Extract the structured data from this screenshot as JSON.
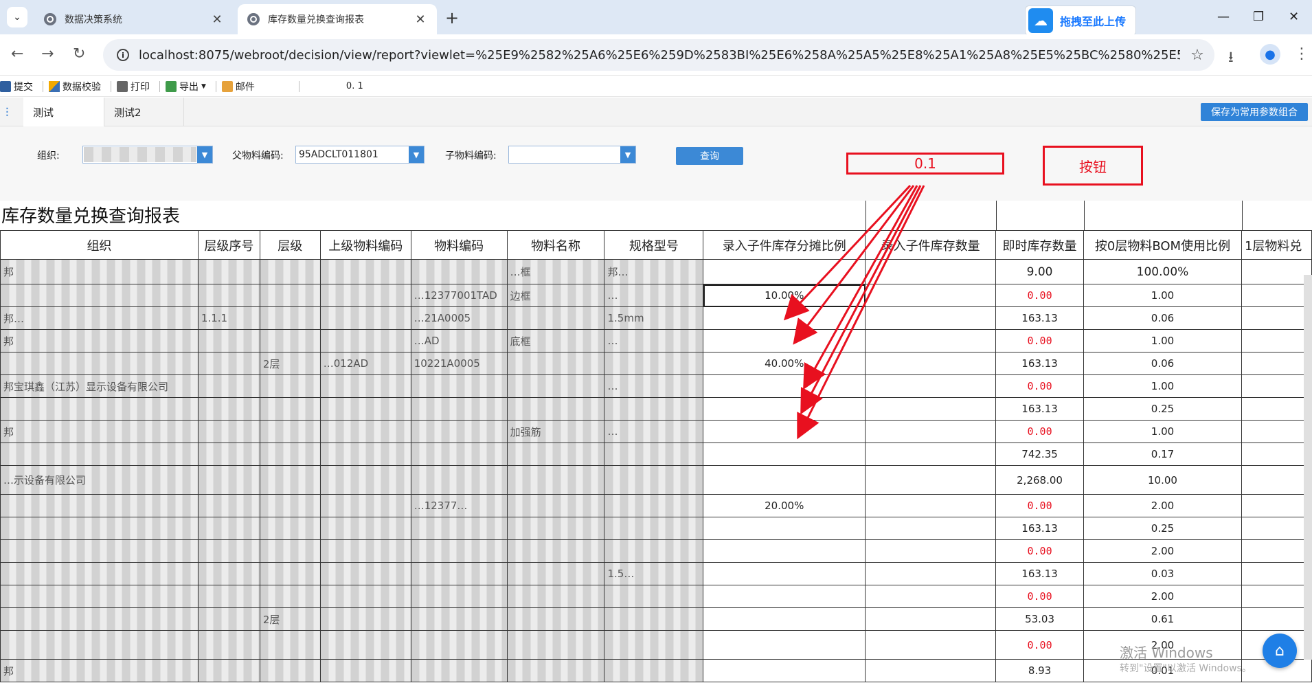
{
  "browser": {
    "tabs": [
      {
        "title": "数据决策系统",
        "active": false
      },
      {
        "title": "库存数量兑换查询报表",
        "active": true
      }
    ],
    "new_tab": "+",
    "upload_label": "拖拽至此上传",
    "url": "localhost:8075/webroot/decision/view/report?viewlet=%25E9%2582%25A6%25E6%259D%2583BI%25E6%258A%25A5%25E8%25A1%25A8%25E5%25BC%2580%25E5%258F%259..."
  },
  "toolbar": {
    "items": [
      "提交",
      "数据校验",
      "打印",
      "导出",
      "邮件"
    ],
    "value_text": "0. 1"
  },
  "param_tabs": {
    "tabs": [
      "测试",
      "测试2"
    ],
    "save_button": "保存为常用参数组合"
  },
  "params": {
    "org_label": "组织:",
    "parent_code_label": "父物料编码:",
    "parent_code_value": "95ADCLT011801",
    "child_code_label": "子物料编码:",
    "child_code_value": "",
    "query_button": "查询"
  },
  "annotations": {
    "value_box": "0.1",
    "button_box": "按钮"
  },
  "report": {
    "title": "库存数量兑换查询报表",
    "columns": [
      "组织",
      "层级序号",
      "层级",
      "上级物料编码",
      "物料编码",
      "物料名称",
      "规格型号",
      "录入子件库存分摊比例",
      "录入子件库存数量",
      "即时库存数量",
      "按0层物料BOM使用比例",
      "1层物料兑"
    ],
    "rows": [
      {
        "org": "邦",
        "seq": "",
        "level": "",
        "parent": "",
        "code": "",
        "name": "…框",
        "spec": "邦…",
        "ratio": "",
        "qty": "",
        "stock": "9.00",
        "bom": "100.00%",
        "red": false,
        "height": 36
      },
      {
        "org": "",
        "seq": "",
        "level": "",
        "parent": "",
        "code": "…12377001TAD",
        "name": "边框",
        "spec": "…",
        "ratio": "10.00%",
        "qty": "",
        "stock": "0.00",
        "bom": "1.00",
        "red": true,
        "height": 33
      },
      {
        "org": "邦…",
        "seq": "1.1.1",
        "level": "",
        "parent": "",
        "code": "…21A0005",
        "name": "",
        "spec": "1.5mm",
        "ratio": "",
        "qty": "",
        "stock": "163.13",
        "bom": "0.06",
        "red": false,
        "height": 33
      },
      {
        "org": "邦",
        "seq": "",
        "level": "",
        "parent": "",
        "code": "…AD",
        "name": "底框",
        "spec": "…",
        "ratio": "",
        "qty": "",
        "stock": "0.00",
        "bom": "1.00",
        "red": true,
        "height": 33
      },
      {
        "org": "",
        "seq": "",
        "level": "2层",
        "parent": "…012AD",
        "code": "10221A0005",
        "name": "",
        "spec": "",
        "ratio": "40.00%",
        "qty": "",
        "stock": "163.13",
        "bom": "0.06",
        "red": false,
        "height": 33
      },
      {
        "org": "邦宝琪鑫（江苏）显示设备有限公司",
        "seq": "",
        "level": "",
        "parent": "",
        "code": "",
        "name": "",
        "spec": "…",
        "ratio": "",
        "qty": "",
        "stock": "0.00",
        "bom": "1.00",
        "red": true,
        "height": 33
      },
      {
        "org": "",
        "seq": "",
        "level": "",
        "parent": "",
        "code": "",
        "name": "",
        "spec": "",
        "ratio": "",
        "qty": "",
        "stock": "163.13",
        "bom": "0.25",
        "red": false,
        "height": 33
      },
      {
        "org": "邦",
        "seq": "",
        "level": "",
        "parent": "",
        "code": "",
        "name": "加强筋",
        "spec": "…",
        "ratio": "",
        "qty": "",
        "stock": "0.00",
        "bom": "1.00",
        "red": true,
        "height": 33
      },
      {
        "org": "",
        "seq": "",
        "level": "",
        "parent": "",
        "code": "",
        "name": "",
        "spec": "",
        "ratio": "",
        "qty": "",
        "stock": "742.35",
        "bom": "0.17",
        "red": false,
        "height": 33
      },
      {
        "org": "…示设备有限公司",
        "seq": "",
        "level": "",
        "parent": "",
        "code": "",
        "name": "",
        "spec": "",
        "ratio": "",
        "qty": "",
        "stock": "2,268.00",
        "bom": "10.00",
        "red": false,
        "height": 42
      },
      {
        "org": "",
        "seq": "",
        "level": "",
        "parent": "",
        "code": "…12377…",
        "name": "",
        "spec": "",
        "ratio": "20.00%",
        "qty": "",
        "stock": "0.00",
        "bom": "2.00",
        "red": true,
        "height": 33
      },
      {
        "org": "",
        "seq": "",
        "level": "",
        "parent": "",
        "code": "",
        "name": "",
        "spec": "",
        "ratio": "",
        "qty": "",
        "stock": "163.13",
        "bom": "0.25",
        "red": false,
        "height": 33
      },
      {
        "org": "",
        "seq": "",
        "level": "",
        "parent": "",
        "code": "",
        "name": "",
        "spec": "",
        "ratio": "",
        "qty": "",
        "stock": "0.00",
        "bom": "2.00",
        "red": true,
        "height": 33
      },
      {
        "org": "",
        "seq": "",
        "level": "",
        "parent": "",
        "code": "",
        "name": "",
        "spec": "1.5…",
        "ratio": "",
        "qty": "",
        "stock": "163.13",
        "bom": "0.03",
        "red": false,
        "height": 33
      },
      {
        "org": "",
        "seq": "",
        "level": "",
        "parent": "",
        "code": "",
        "name": "",
        "spec": "",
        "ratio": "",
        "qty": "",
        "stock": "0.00",
        "bom": "2.00",
        "red": true,
        "height": 33
      },
      {
        "org": "",
        "seq": "",
        "level": "2层",
        "parent": "",
        "code": "",
        "name": "",
        "spec": "",
        "ratio": "",
        "qty": "",
        "stock": "53.03",
        "bom": "0.61",
        "red": false,
        "height": 33
      },
      {
        "org": "",
        "seq": "",
        "level": "",
        "parent": "",
        "code": "",
        "name": "",
        "spec": "",
        "ratio": "",
        "qty": "",
        "stock": "0.00",
        "bom": "2.00",
        "red": true,
        "height": 42
      },
      {
        "org": "邦",
        "seq": "",
        "level": "",
        "parent": "",
        "code": "",
        "name": "",
        "spec": "",
        "ratio": "",
        "qty": "",
        "stock": "8.93",
        "bom": "0.01",
        "red": false,
        "height": 33
      }
    ]
  },
  "watermark": {
    "line1": "激活 Windows",
    "line2": "转到\"设置\"以激活 Windows。"
  },
  "colors": {
    "accent": "#3c89d6",
    "annotation": "#e8101f",
    "tabbar": "#dee8f5"
  }
}
